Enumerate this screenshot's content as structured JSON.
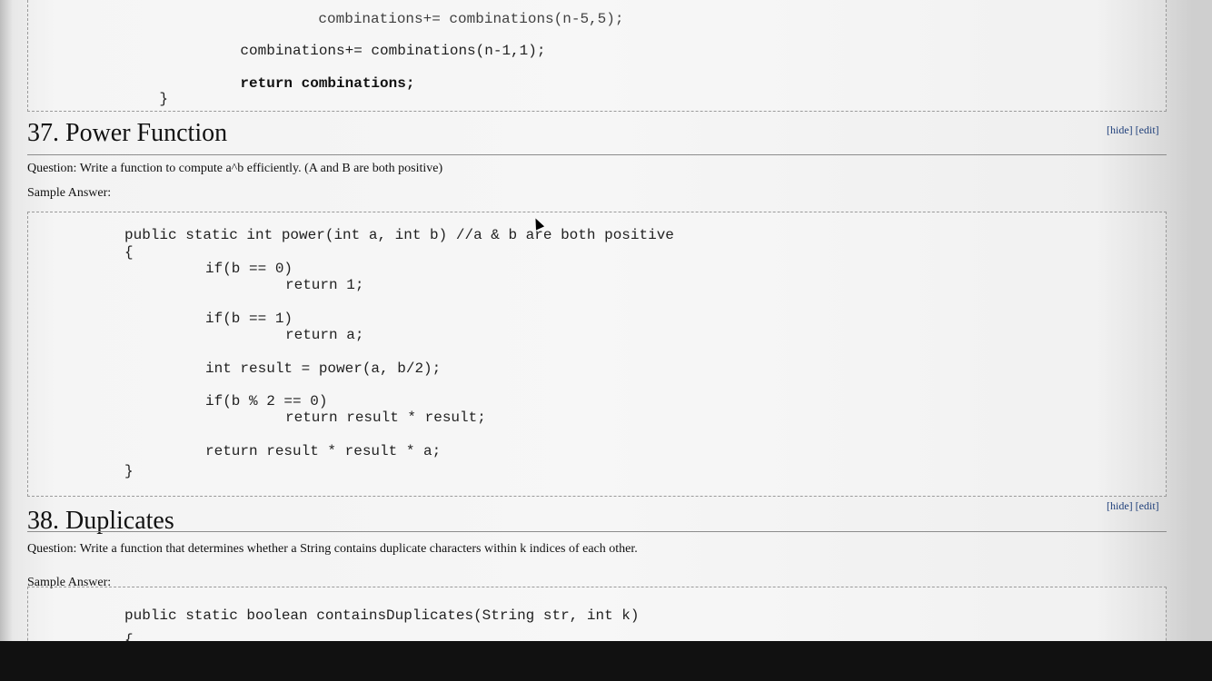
{
  "prev": {
    "lines": [
      "combinations+= combinations(n-5,5);",
      "combinations+= combinations(n-1,1);",
      "return combinations;",
      "}"
    ]
  },
  "sections": [
    {
      "title": "37. Power Function",
      "hide": "[hide]",
      "edit": "[edit]",
      "question": "Question: Write a function to compute a^b efficiently. (A and B are both positive)",
      "sample": "Sample Answer:"
    },
    {
      "title": "38. Duplicates",
      "hide": "[hide]",
      "edit": "[edit]",
      "question": "Question: Write a function that determines whether a String contains duplicate characters within k indices of each other.",
      "sample": "Sample Answer:"
    }
  ],
  "code37": {
    "sig": "public static int power(int a, int b) //a & b are both positive",
    "lines": [
      "{",
      "if(b == 0)",
      "return 1;",
      "if(b == 1)",
      "return a;",
      "int result = power(a, b/2);",
      "if(b % 2 == 0)",
      "return result * result;",
      "return result * result * a;",
      "}"
    ]
  },
  "code38": {
    "sig": "public static boolean containsDuplicates(String str, int k)",
    "lines": [
      "{"
    ]
  }
}
